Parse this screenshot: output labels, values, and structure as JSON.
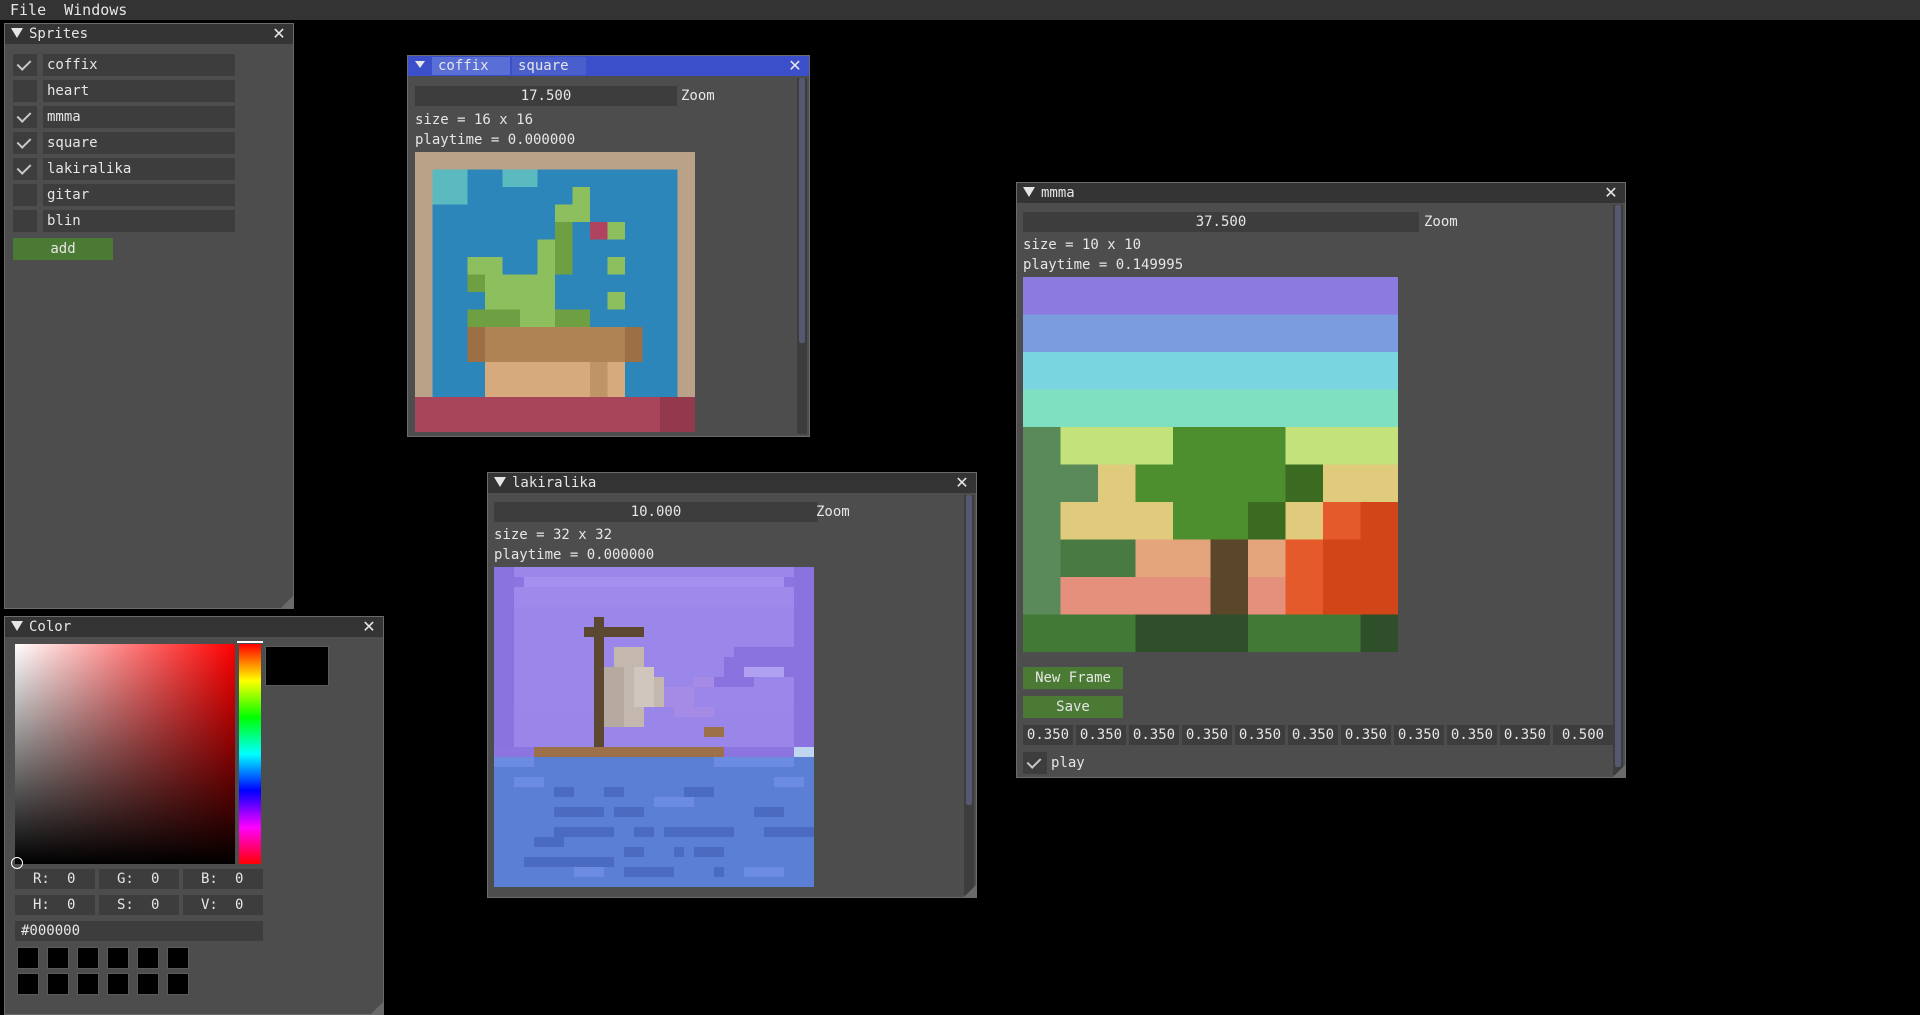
{
  "menubar": {
    "file": "File",
    "windows": "Windows"
  },
  "sprites_window": {
    "title": "Sprites",
    "items": [
      {
        "label": "coffix",
        "checked": true
      },
      {
        "label": "heart",
        "checked": false
      },
      {
        "label": "mmma",
        "checked": true
      },
      {
        "label": "square",
        "checked": true
      },
      {
        "label": "lakiralika",
        "checked": true
      },
      {
        "label": "gitar",
        "checked": false
      },
      {
        "label": "blin",
        "checked": false
      }
    ],
    "add_label": "add"
  },
  "color_window": {
    "title": "Color",
    "current_color": "#000000",
    "r_label": "R:",
    "r": "0",
    "g_label": "G:",
    "g": "0",
    "b_label": "B:",
    "b": "0",
    "h_label": "H:",
    "h": "0",
    "s_label": "S:",
    "s": "0",
    "v_label": "V:",
    "v": "0",
    "hex": "#000000"
  },
  "coffix_window": {
    "tabs": [
      "coffix",
      "square"
    ],
    "active_tab": "coffix",
    "zoom_value": "17.500",
    "zoom_label": "Zoom",
    "size_text": "size = 16 x 16",
    "playtime_text": "playtime = 0.000000"
  },
  "lakiralika_window": {
    "title": "lakiralika",
    "zoom_value": "10.000",
    "zoom_label": "Zoom",
    "size_text": "size = 32 x 32",
    "playtime_text": "playtime = 0.000000"
  },
  "mmma_window": {
    "title": "mmma",
    "zoom_value": "37.500",
    "zoom_label": "Zoom",
    "size_text": "size = 10 x 10",
    "playtime_text": "playtime = 0.149995",
    "new_frame_label": "New Frame",
    "save_label": "Save",
    "frame_durations": [
      "0.350",
      "0.350",
      "0.350",
      "0.350",
      "0.350",
      "0.350",
      "0.350",
      "0.350",
      "0.350",
      "0.350",
      "0.500"
    ],
    "play_label": "play",
    "play_checked": true
  },
  "palette": {
    "accent": "#3a4fc9",
    "button_green": "#4a7a33",
    "window_bg": "#4d4d4d"
  }
}
